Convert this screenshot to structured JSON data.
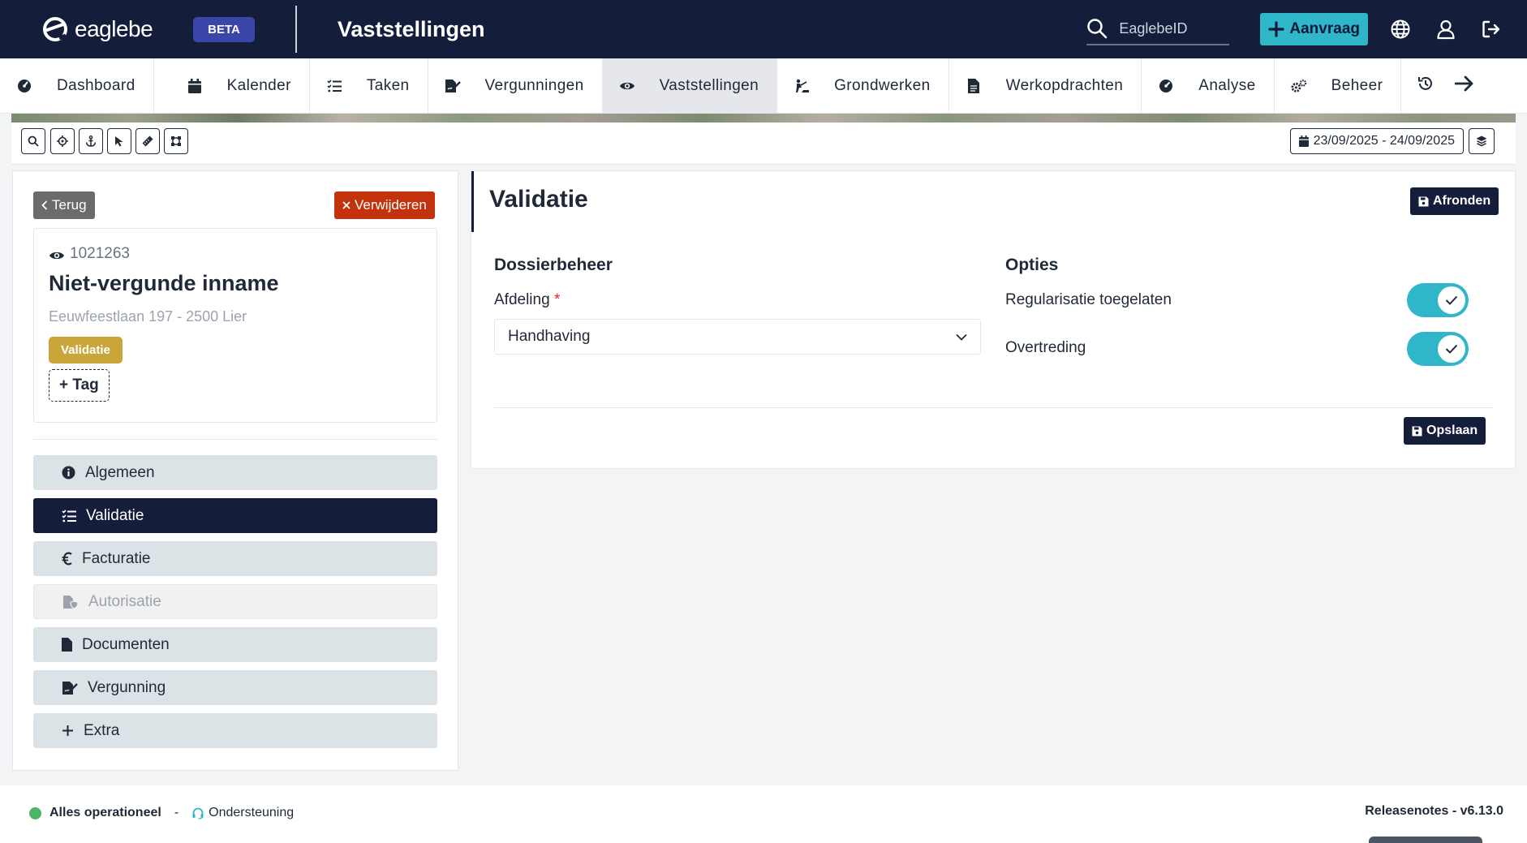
{
  "app": {
    "brand": "eaglebe",
    "beta": "BETA",
    "page_title": "Vaststellingen",
    "search_placeholder": "EaglebeID",
    "aanvraag": "Aanvraag"
  },
  "nav": {
    "items": [
      {
        "label": "Dashboard",
        "icon": "dashboard-icon"
      },
      {
        "label": "Kalender",
        "icon": "calendar-icon"
      },
      {
        "label": "Taken",
        "icon": "tasks-icon"
      },
      {
        "label": "Vergunningen",
        "icon": "permit-icon"
      },
      {
        "label": "Vaststellingen",
        "icon": "eye-icon",
        "active": true
      },
      {
        "label": "Grondwerken",
        "icon": "digging-icon"
      },
      {
        "label": "Werkopdrachten",
        "icon": "document-icon"
      },
      {
        "label": "Analyse",
        "icon": "gauge-icon"
      },
      {
        "label": "Beheer",
        "icon": "gears-icon"
      }
    ]
  },
  "toolbar": {
    "date_range": "23/09/2025 - 24/09/2025",
    "tools": [
      "search-icon",
      "crosshair-icon",
      "anchor-icon",
      "pointer-icon",
      "ruler-icon",
      "polygon-icon"
    ]
  },
  "left": {
    "back": "Terug",
    "delete": "Verwijderen",
    "record": {
      "id": "1021263",
      "title": "Niet-vergunde inname",
      "address": "Eeuwfeestlaan 197 - 2500 Lier",
      "status": "Validatie",
      "add_tag": "+ Tag"
    },
    "menu": [
      {
        "label": "Algemeen",
        "icon": "info-icon"
      },
      {
        "label": "Validatie",
        "icon": "list-check-icon",
        "active": true
      },
      {
        "label": "Facturatie",
        "icon": "euro-icon"
      },
      {
        "label": "Autorisatie",
        "icon": "file-shield-icon",
        "disabled": true
      },
      {
        "label": "Documenten",
        "icon": "file-icon"
      },
      {
        "label": "Vergunning",
        "icon": "file-signature-icon"
      },
      {
        "label": "Extra",
        "icon": "plus-icon"
      }
    ]
  },
  "main": {
    "title": "Validatie",
    "finish": "Afronden",
    "dossier_title": "Dossierbeheer",
    "afdeling_label": "Afdeling",
    "required_mark": "*",
    "afdeling_value": "Handhaving",
    "options_title": "Opties",
    "options": [
      {
        "label": "Regularisatie toegelaten",
        "on": true
      },
      {
        "label": "Overtreding",
        "on": true
      }
    ],
    "save": "Opslaan"
  },
  "footer": {
    "status": "Alles operationeel",
    "separator": "-",
    "support": "Ondersteuning",
    "release": "Releasenotes - v6.13.0"
  },
  "colors": {
    "navy": "#141d3a",
    "teal": "#2fb7c9",
    "danger": "#c2330d",
    "badge": "#c9a53a",
    "ok": "#4ab563"
  }
}
